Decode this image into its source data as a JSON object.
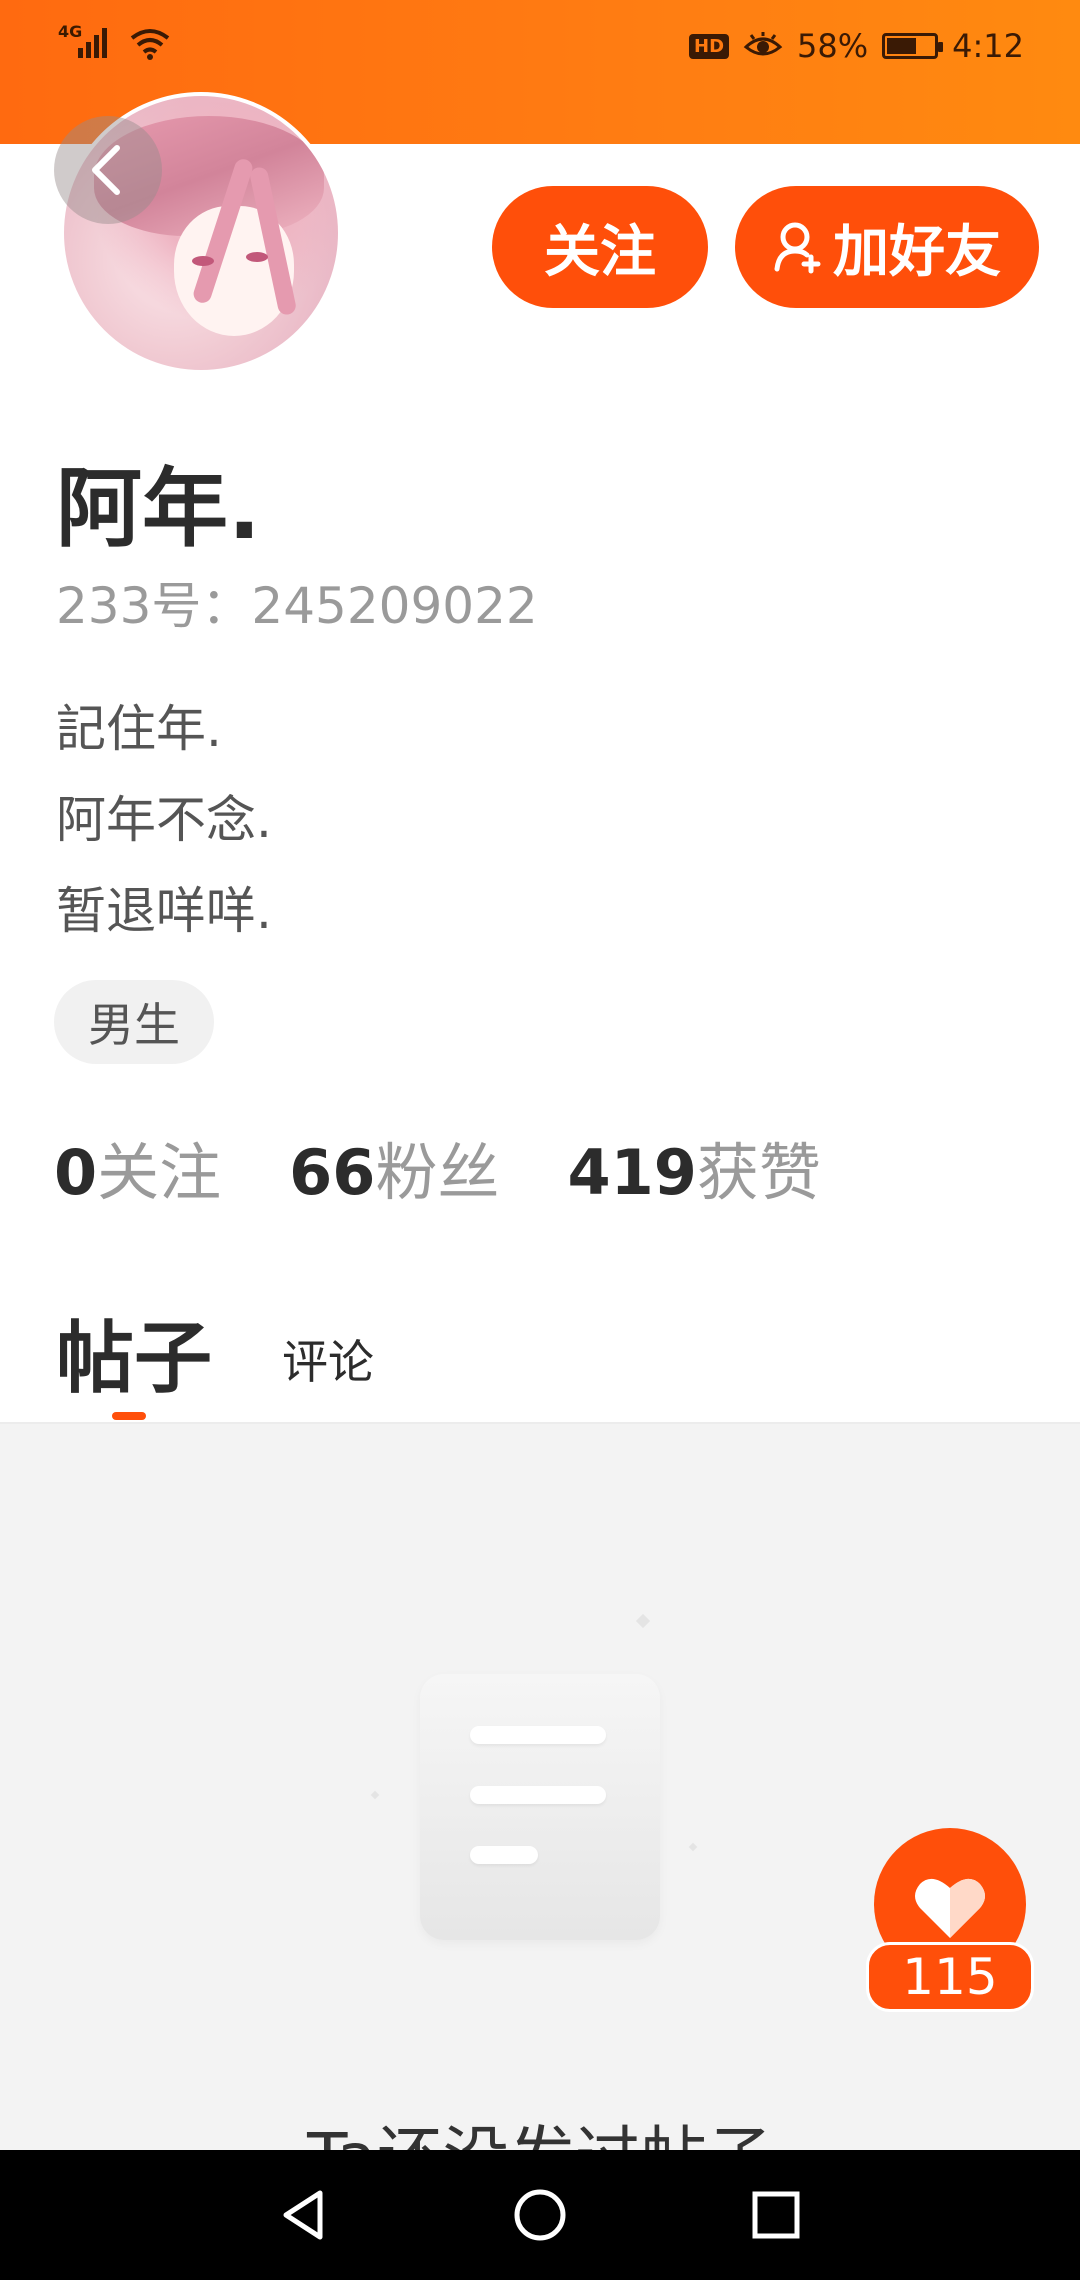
{
  "status_bar": {
    "network": "4G",
    "hd_label": "HD",
    "battery_percent": "58%",
    "battery_level": 0.58,
    "time": "4:12"
  },
  "profile": {
    "name": "阿年.",
    "id_text": "233号：245209022",
    "bio_lines": [
      "記住年.",
      "阿年不念.",
      "暂退咩咩."
    ],
    "gender_tag": "男生"
  },
  "actions": {
    "follow_label": "关注",
    "add_friend_label": "加好友"
  },
  "stats": [
    {
      "value": "0",
      "label": "关注"
    },
    {
      "value": "66",
      "label": "粉丝"
    },
    {
      "value": "419",
      "label": "获赞"
    }
  ],
  "tabs": [
    {
      "label": "帖子",
      "active": true
    },
    {
      "label": "评论",
      "active": false
    }
  ],
  "empty_state": {
    "message": "Ta还没发过帖子"
  },
  "like_fab": {
    "count": "115"
  },
  "colors": {
    "accent": "#ff4f0a",
    "status_bar_start": "#ff6a10",
    "status_bar_end": "#ff8a10"
  },
  "icons": {
    "back": "chevron-left-icon",
    "add_friend": "user-plus-icon",
    "like": "heart-icon",
    "empty": "document-icon",
    "nav_back": "triangle-back-icon",
    "nav_home": "circle-home-icon",
    "nav_recents": "square-recents-icon"
  }
}
